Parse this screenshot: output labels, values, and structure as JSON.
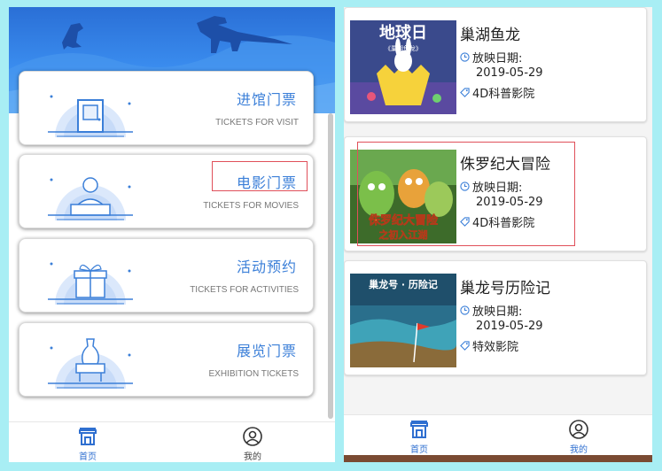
{
  "left": {
    "tickets": [
      {
        "cn": "进馆门票",
        "en": "TICKETS FOR VISIT"
      },
      {
        "cn": "电影门票",
        "en": "TICKETS FOR MOVIES"
      },
      {
        "cn": "活动预约",
        "en": "TICKETS FOR ACTIVITIES"
      },
      {
        "cn": "展览门票",
        "en": "EXHIBITION TICKETS"
      }
    ],
    "tabs": [
      {
        "label": "首页",
        "icon": "home-icon"
      },
      {
        "label": "我的",
        "icon": "user-icon"
      }
    ]
  },
  "right": {
    "date_label": "放映日期:",
    "movies": [
      {
        "title": "巢湖鱼龙",
        "date": "2019-05-29",
        "venue": "4D科普影院",
        "poster_text": "地球日",
        "poster_sub": "《巢湖鱼龙》"
      },
      {
        "title": "侏罗纪大冒险",
        "date": "2019-05-29",
        "venue": "4D科普影院",
        "poster_text": "侏罗纪大冒险",
        "poster_sub": "之初入江湖"
      },
      {
        "title": "巢龙号历险记",
        "date": "2019-05-29",
        "venue": "特效影院",
        "poster_text": "巢龙号 · 历险记",
        "poster_sub": ""
      }
    ],
    "tabs": [
      {
        "label": "首页",
        "icon": "home-icon"
      },
      {
        "label": "我的",
        "icon": "user-icon"
      }
    ]
  },
  "colors": {
    "accent": "#2f6fd0",
    "highlight": "#e0505a",
    "background": "#a8eef4"
  }
}
